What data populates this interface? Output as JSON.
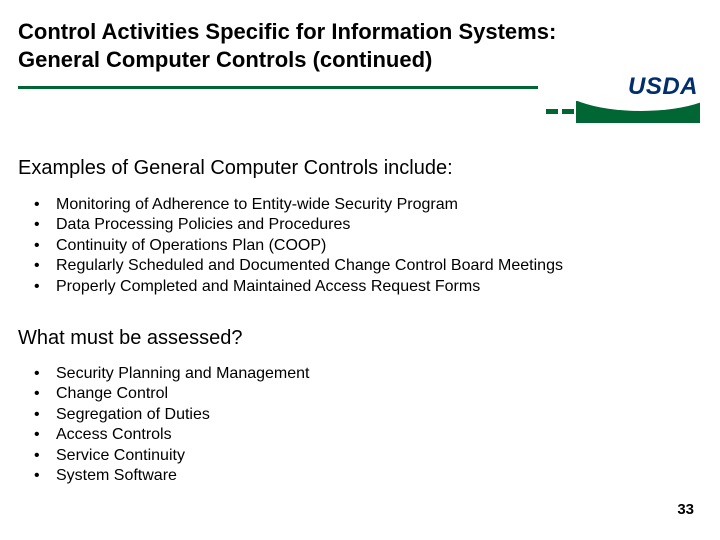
{
  "title_line1": "Control Activities Specific for Information Systems:",
  "title_line2": "General Computer Controls (continued)",
  "logo_text": "USDA",
  "subhead1": "Examples of General Computer Controls include:",
  "examples": [
    "Monitoring of Adherence to Entity-wide Security Program",
    "Data Processing Policies and Procedures",
    "Continuity of Operations Plan (COOP)",
    "Regularly Scheduled and Documented Change Control Board Meetings",
    "Properly Completed and Maintained Access Request Forms"
  ],
  "subhead2": "What must be assessed?",
  "assess": [
    "Security Planning and Management",
    "Change Control",
    "Segregation of Duties",
    "Access Controls",
    "Service Continuity",
    "System Software"
  ],
  "page_number": "33"
}
